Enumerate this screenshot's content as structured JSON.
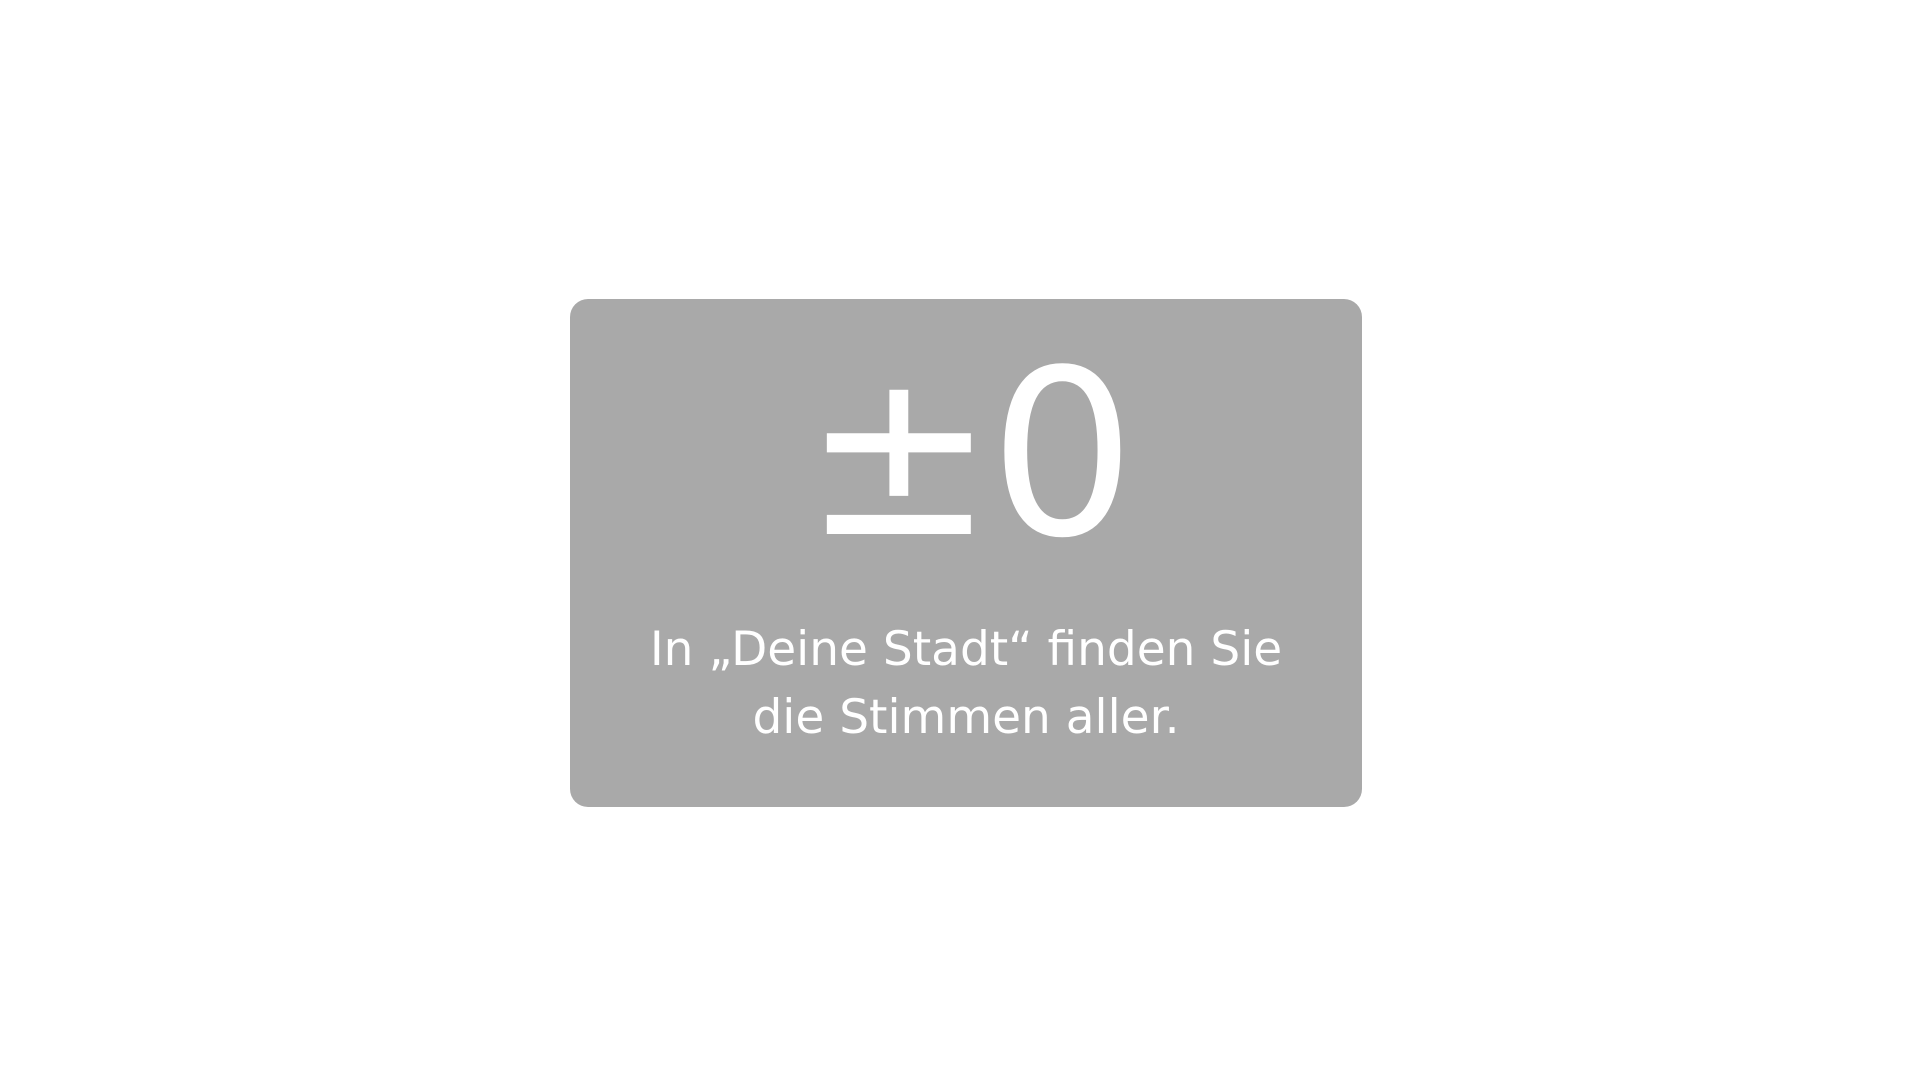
{
  "card": {
    "value": "±0",
    "caption_line1": "In „Deine Stadt“ finden Sie",
    "caption_line2": "die Stimmen aller.",
    "background_color": "#a9a9a9",
    "text_color": "#ffffff"
  }
}
